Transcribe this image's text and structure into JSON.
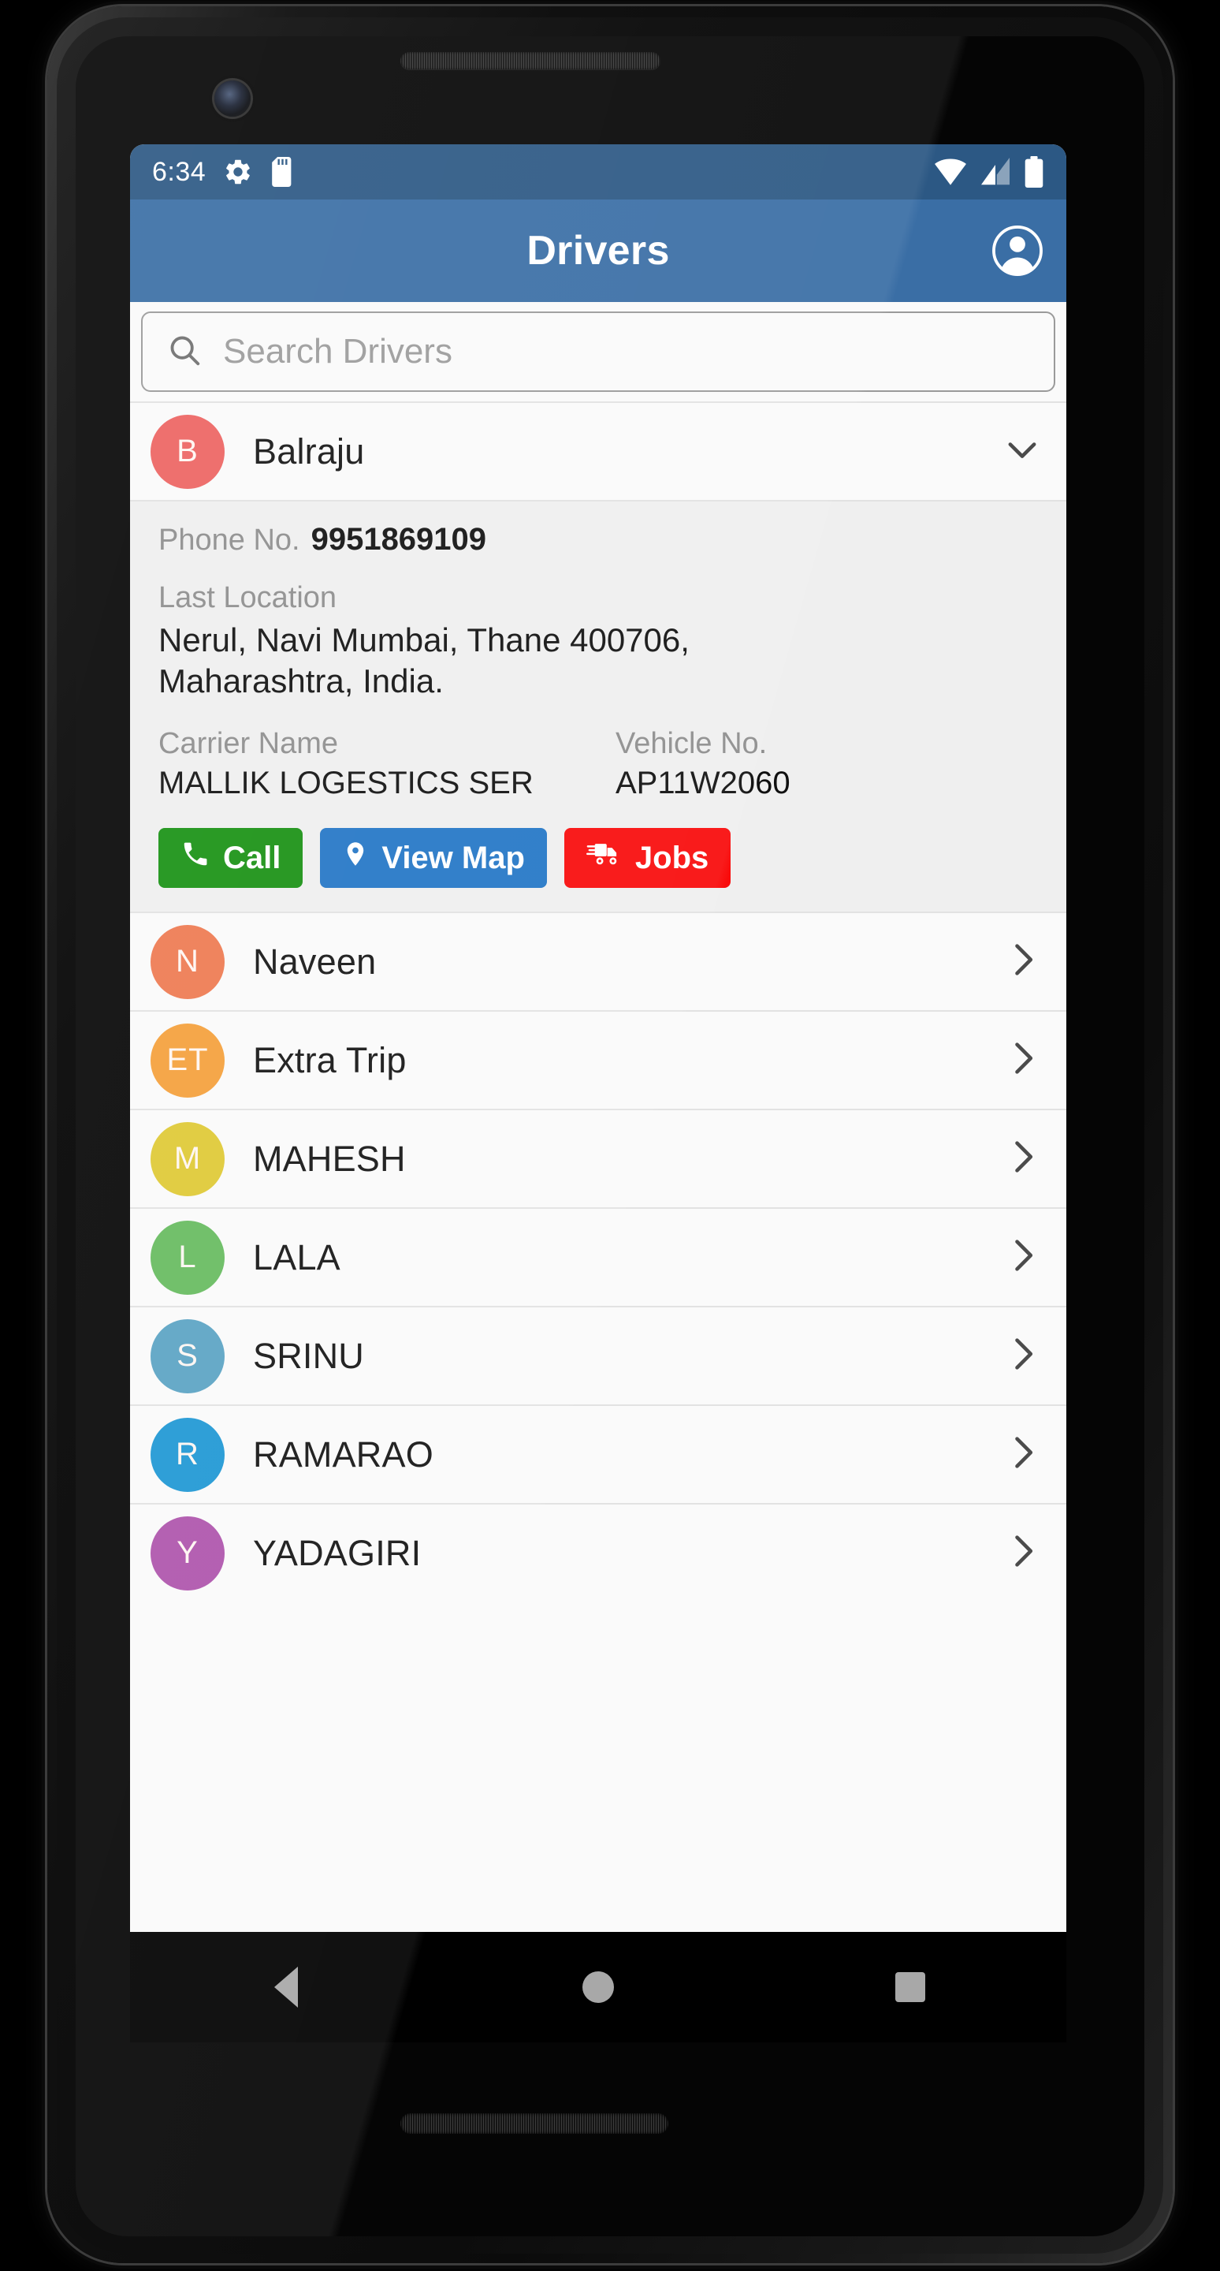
{
  "status_bar": {
    "time": "6:34",
    "left_icons": [
      "gear-icon",
      "sd-card-icon"
    ],
    "right_icons": [
      "wifi-icon",
      "cell-signal-icon",
      "battery-icon"
    ],
    "background_color": "#2C5884"
  },
  "app_bar": {
    "title": "Drivers",
    "account_icon": "account-circle-icon",
    "background_color": "#3A6EA5"
  },
  "search": {
    "placeholder": "Search Drivers",
    "icon": "search-icon",
    "value": ""
  },
  "expanded_driver": {
    "name": "Balraju",
    "initials": "B",
    "avatar_color": "#EC6361",
    "chevron": "chevron-down-icon",
    "phone_label": "Phone No.",
    "phone_value": "9951869109",
    "last_location_label": "Last Location",
    "last_location_value": "Nerul, Navi Mumbai, Thane 400706, Maharashtra, India.",
    "carrier_label": "Carrier Name",
    "carrier_value": "MALLIK LOGESTICS SER",
    "vehicle_label": "Vehicle No.",
    "vehicle_value": "AP11W2060",
    "actions": [
      {
        "label": "Call",
        "icon": "phone-icon",
        "color": "#189113"
      },
      {
        "label": "View Map",
        "icon": "map-pin-icon",
        "color": "#2376C6"
      },
      {
        "label": "Jobs",
        "icon": "delivery-truck-icon",
        "color": "#F90B0B"
      }
    ]
  },
  "drivers": [
    {
      "name": "Naveen",
      "initials": "N",
      "avatar_color": "#EE7A51",
      "chevron": "chevron-right-icon"
    },
    {
      "name": "Extra Trip",
      "initials": "ET",
      "avatar_color": "#F4A03B",
      "chevron": "chevron-right-icon"
    },
    {
      "name": "MAHESH",
      "initials": "M",
      "avatar_color": "#DFC935",
      "chevron": "chevron-right-icon"
    },
    {
      "name": "LALA",
      "initials": "L",
      "avatar_color": "#66BB5F",
      "chevron": "chevron-right-icon"
    },
    {
      "name": "SRINU",
      "initials": "S",
      "avatar_color": "#5BA3C4",
      "chevron": "chevron-right-icon"
    },
    {
      "name": "RAMARAO",
      "initials": "R",
      "avatar_color": "#1E97D4",
      "chevron": "chevron-right-icon"
    },
    {
      "name": "YADAGIRI",
      "initials": "Y",
      "avatar_color": "#AE54AC",
      "chevron": "chevron-right-icon"
    }
  ],
  "nav_bar": {
    "back": "back-triangle-icon",
    "home": "home-circle-icon",
    "recents": "recents-square-icon"
  }
}
